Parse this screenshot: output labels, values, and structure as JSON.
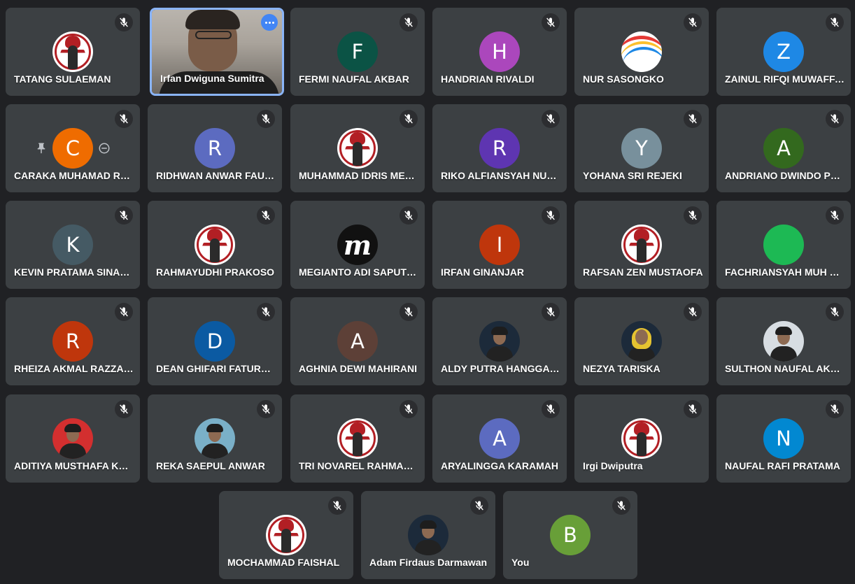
{
  "colors": {
    "background": "#202124",
    "tile": "#3c4043",
    "active_border": "#8ab4f8",
    "mute_badge": "#2c2d30",
    "more_button": "#4285f4"
  },
  "participants": [
    {
      "name": "TATANG SULAEMAN",
      "avatar": {
        "kind": "logo"
      }
    },
    {
      "name": "Irfan Dwiguna Sumitra",
      "avatar": {
        "kind": "video"
      },
      "active": true
    },
    {
      "name": "FERMI NAUFAL AKBAR",
      "avatar": {
        "kind": "letter",
        "letter": "F",
        "color": "#0b5345"
      }
    },
    {
      "name": "HANDRIAN RIVALDI",
      "avatar": {
        "kind": "letter",
        "letter": "H",
        "color": "#ab47bc"
      }
    },
    {
      "name": "NUR SASONGKO",
      "avatar": {
        "kind": "nur"
      }
    },
    {
      "name": "ZAINUL RIFQI MUWAFFAQ",
      "avatar": {
        "kind": "letter",
        "letter": "Z",
        "color": "#1e88e5"
      }
    },
    {
      "name": "CARAKA MUHAMAD RAMADHAN",
      "avatar": {
        "kind": "letter",
        "letter": "C",
        "color": "#ef6c00"
      },
      "hover": true
    },
    {
      "name": "RIDHWAN ANWAR FAUZAN",
      "avatar": {
        "kind": "letter",
        "letter": "R",
        "color": "#5c6bc0"
      }
    },
    {
      "name": "MUHAMMAD IDRIS MERDEKA",
      "avatar": {
        "kind": "logo"
      }
    },
    {
      "name": "RIKO ALFIANSYAH NUGRAHA",
      "avatar": {
        "kind": "letter",
        "letter": "R",
        "color": "#5e35b1"
      }
    },
    {
      "name": "YOHANA SRI REJEKI",
      "avatar": {
        "kind": "letter",
        "letter": "Y",
        "color": "#78909c"
      }
    },
    {
      "name": "ANDRIANO DWINDO PUTRA",
      "avatar": {
        "kind": "letter",
        "letter": "A",
        "color": "#33691e"
      }
    },
    {
      "name": "KEVIN PRATAMA SINAGA",
      "avatar": {
        "kind": "letter",
        "letter": "K",
        "color": "#455a64"
      }
    },
    {
      "name": "RAHMAYUDHI PRAKOSO",
      "avatar": {
        "kind": "logo"
      }
    },
    {
      "name": "MEGIANTO ADI SAPUTRA",
      "avatar": {
        "kind": "m"
      }
    },
    {
      "name": "IRFAN GINANJAR",
      "avatar": {
        "kind": "letter",
        "letter": "I",
        "color": "#bf360c"
      }
    },
    {
      "name": "RAFSAN ZEN MUSTAOFA",
      "avatar": {
        "kind": "logo"
      }
    },
    {
      "name": "FACHRIANSYAH MUH NUR",
      "avatar": {
        "kind": "letter",
        "letter": "",
        "color": "#1db954"
      }
    },
    {
      "name": "RHEIZA AKMAL RAZZAKY",
      "avatar": {
        "kind": "letter",
        "letter": "R",
        "color": "#bf360c"
      }
    },
    {
      "name": "DEAN GHIFARI FATURRAHMAN",
      "avatar": {
        "kind": "letter",
        "letter": "D",
        "color": "#0b5aa2"
      }
    },
    {
      "name": "AGHNIA DEWI MAHIRANI",
      "avatar": {
        "kind": "letter",
        "letter": "A",
        "color": "#5d4037"
      }
    },
    {
      "name": "ALDY PUTRA HANGGARA",
      "avatar": {
        "kind": "face",
        "bg": "#1c2a3a"
      }
    },
    {
      "name": "NEZYA TARISKA",
      "avatar": {
        "kind": "hijab",
        "bg": "#1c2a3a"
      }
    },
    {
      "name": "SULTHON NAUFAL AKMAL",
      "avatar": {
        "kind": "face",
        "bg": "#d7dde2"
      }
    },
    {
      "name": "ADITIYA MUSTHAFA KAMAL",
      "avatar": {
        "kind": "face",
        "bg": "#d32f2f"
      }
    },
    {
      "name": "REKA SAEPUL ANWAR",
      "avatar": {
        "kind": "face",
        "bg": "#7ab0c8"
      }
    },
    {
      "name": "TRI NOVAREL RAHMADANI",
      "avatar": {
        "kind": "logo"
      }
    },
    {
      "name": "ARYALINGGA KARAMAH",
      "avatar": {
        "kind": "letter",
        "letter": "A",
        "color": "#5c6bc0"
      }
    },
    {
      "name": "Irgi Dwiputra",
      "avatar": {
        "kind": "logo"
      }
    },
    {
      "name": "NAUFAL RAFI PRATAMA",
      "avatar": {
        "kind": "letter",
        "letter": "N",
        "color": "#0288d1"
      }
    },
    {
      "name": "MOCHAMMAD FAISHAL",
      "avatar": {
        "kind": "logo"
      }
    },
    {
      "name": "Adam Firdaus Darmawan",
      "avatar": {
        "kind": "face",
        "bg": "#1c2a3a"
      }
    },
    {
      "name": "You",
      "avatar": {
        "kind": "letter",
        "letter": "B",
        "color": "#689f38"
      }
    }
  ]
}
